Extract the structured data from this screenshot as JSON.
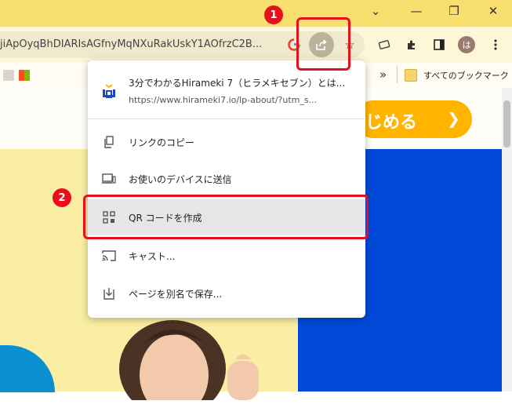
{
  "window": {
    "minimize_glyph": "—",
    "restore_glyph": "❐",
    "close_glyph": "✕",
    "tabs_dropdown_glyph": "⌄"
  },
  "omnibox": {
    "url_text": "jiApOyqBhDIARIsAGfnyMqNXuRakUskY1AOfrzC2B..."
  },
  "profile": {
    "initial": "は"
  },
  "bookmarks": {
    "overflow_glyph": "»",
    "all_bookmarks_label": "すべてのブックマーク"
  },
  "page": {
    "cta_label": "じめる",
    "cta_arrow": "❯"
  },
  "share_menu": {
    "page_title": "3分でわかるHirameki 7（ヒラメキセブン）とは...",
    "page_url": "https://www.hirameki7.io/lp-about/?utm_s...",
    "items": [
      {
        "label": "リンクのコピー",
        "icon": "copy-icon"
      },
      {
        "label": "お使いのデバイスに送信",
        "icon": "send-to-devices-icon"
      },
      {
        "label": "QR コードを作成",
        "icon": "qr-code-icon"
      },
      {
        "label": "キャスト...",
        "icon": "cast-icon"
      },
      {
        "label": "ページを別名で保存...",
        "icon": "save-page-icon"
      }
    ]
  },
  "annotations": {
    "step1": "1",
    "step2": "2",
    "highlight_color": "#e8101a"
  }
}
